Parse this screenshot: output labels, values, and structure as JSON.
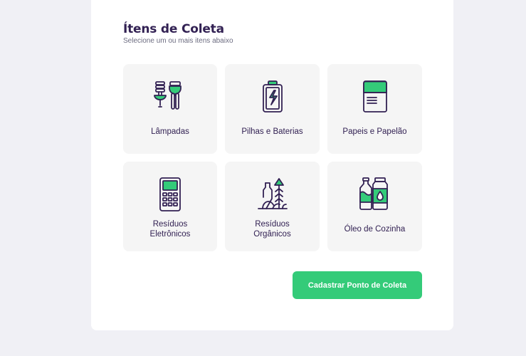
{
  "form": {
    "title": "Ítens de Coleta",
    "subtitle": "Selecione um ou mais itens abaixo"
  },
  "items": [
    {
      "label": "Lâmpadas",
      "icon": "lamp-icon"
    },
    {
      "label": "Pilhas e Baterias",
      "icon": "battery-icon"
    },
    {
      "label": "Papeis e Papelão",
      "icon": "paper-icon"
    },
    {
      "label": "Resíduos Eletrônicos",
      "icon": "electronic-device-icon"
    },
    {
      "label": "Resíduos Orgânicos",
      "icon": "organic-waste-icon"
    },
    {
      "label": "Óleo de Cozinha",
      "icon": "oil-bottle-icon"
    }
  ],
  "actions": {
    "submit_label": "Cadastrar Ponto de Coleta"
  },
  "colors": {
    "accent": "#34cb79",
    "title": "#322153",
    "text": "#6c6c80",
    "page_bg": "#f0f0f5",
    "item_bg": "#f5f5f5"
  }
}
